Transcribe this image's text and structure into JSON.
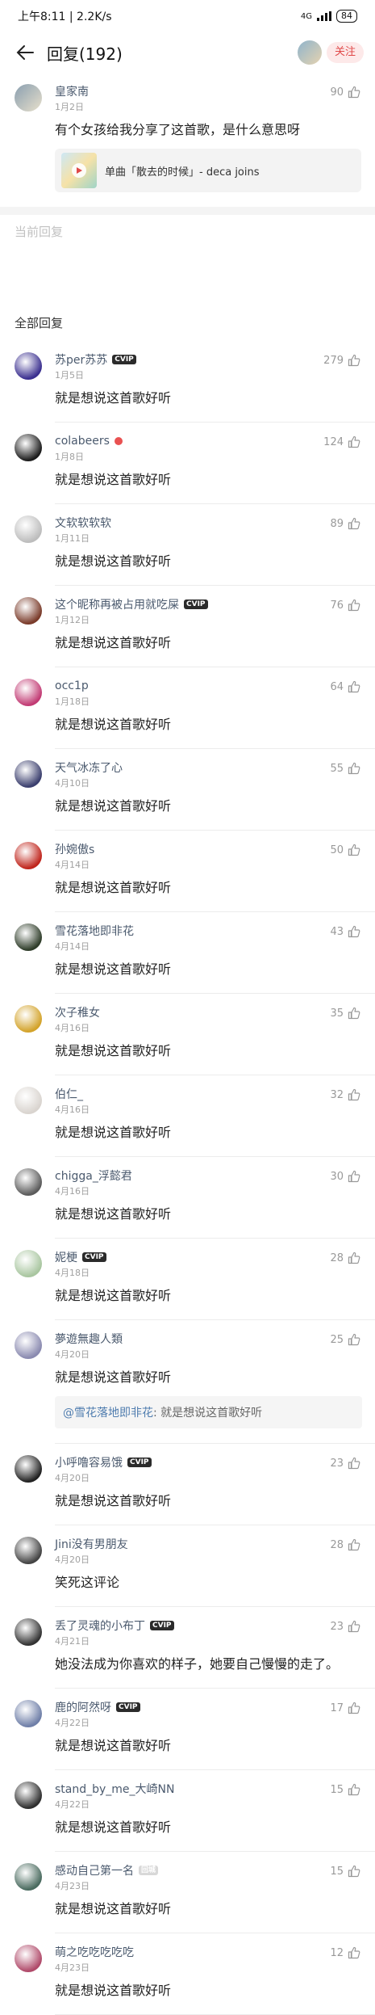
{
  "status": {
    "time_speed": "上午8:11 | 2.2K/s",
    "battery": "84",
    "net": "4G"
  },
  "header": {
    "title": "回复(192)",
    "follow_label": "关注"
  },
  "main_comment": {
    "user": "皇家南",
    "date": "1月2日",
    "likes": "90",
    "text": "有个女孩给我分享了这首歌，是什么意思呀",
    "music": "单曲「散去的时候」- deca joins"
  },
  "sections": {
    "current": "当前回复",
    "all": "全部回复"
  },
  "replies": [
    {
      "user": "苏per苏苏",
      "badge": "CVIP",
      "date": "1月5日",
      "likes": "279",
      "text": "就是想说这首歌好听",
      "color": "#3a2f8f"
    },
    {
      "user": "colabeers",
      "badge": "red",
      "date": "1月8日",
      "likes": "124",
      "text": "就是想说这首歌好听",
      "color": "#1c1c1c"
    },
    {
      "user": "文软软软软",
      "badge": "",
      "date": "1月11日",
      "likes": "89",
      "text": "就是想说这首歌好听",
      "color": "#bdbdbd"
    },
    {
      "user": "这个昵称再被占用就吃屎",
      "badge": "CVIP",
      "date": "1月12日",
      "likes": "76",
      "text": "就是想说这首歌好听",
      "color": "#7a3b2a"
    },
    {
      "user": "occ1p",
      "badge": "",
      "date": "1月18日",
      "likes": "64",
      "text": "就是想说这首歌好听",
      "color": "#c23b74"
    },
    {
      "user": "天气冰冻了心",
      "badge": "",
      "date": "4月10日",
      "likes": "55",
      "text": "就是想说这首歌好听",
      "color": "#3b3f6e"
    },
    {
      "user": "孙婉傲s",
      "badge": "",
      "date": "4月14日",
      "likes": "50",
      "text": "就是想说这首歌好听",
      "color": "#c0251c"
    },
    {
      "user": "雪花落地即非花",
      "badge": "",
      "date": "4月14日",
      "likes": "43",
      "text": "就是想说这首歌好听",
      "color": "#2f3d2a"
    },
    {
      "user": "次子稚女",
      "badge": "",
      "date": "4月16日",
      "likes": "35",
      "text": "就是想说这首歌好听",
      "color": "#d3a32a"
    },
    {
      "user": "伯仁_",
      "badge": "",
      "date": "4月16日",
      "likes": "32",
      "text": "就是想说这首歌好听",
      "color": "#d9d4cf"
    },
    {
      "user": "chigga_浮懿君",
      "badge": "",
      "date": "4月16日",
      "likes": "30",
      "text": "就是想说这首歌好听",
      "color": "#5b5b5b"
    },
    {
      "user": "妮梗",
      "badge": "CVIP",
      "date": "4月18日",
      "likes": "28",
      "text": "就是想说这首歌好听",
      "color": "#a9c6a0"
    },
    {
      "user": "夢遊無趣人類",
      "badge": "",
      "date": "4月20日",
      "likes": "25",
      "text": "就是想说这首歌好听",
      "color": "#8a8ab0",
      "quote_user": "@雪花落地即非花",
      "quote_text": ": 就是想说这首歌好听"
    },
    {
      "user": "小呼噜容易饿",
      "badge": "CVIP",
      "date": "4月20日",
      "likes": "23",
      "text": "就是想说这首歌好听",
      "color": "#222222"
    },
    {
      "user": "Jini没有男朋友",
      "badge": "",
      "date": "4月20日",
      "likes": "28",
      "text": "笑死这评论",
      "color": "#444444"
    },
    {
      "user": "丢了灵魂的小布丁",
      "badge": "CVIP",
      "date": "4月21日",
      "likes": "23",
      "text": "她没法成为你喜欢的样子，她要自己慢慢的走了。",
      "color": "#333333"
    },
    {
      "user": "鹿的阿然呀",
      "badge": "CVIP",
      "date": "4月22日",
      "likes": "17",
      "text": "就是想说这首歌好听",
      "color": "#6f7fa8"
    },
    {
      "user": "stand_by_me_大崎NN",
      "badge": "",
      "date": "4月22日",
      "likes": "15",
      "text": "就是想说这首歌好听",
      "color": "#2e2e2e"
    },
    {
      "user": "感动自己第一名",
      "badge": "gray",
      "date": "4月23日",
      "likes": "15",
      "text": "就是想说这首歌好听",
      "color": "#4a6b5f"
    },
    {
      "user": "萌之吃吃吃吃吃",
      "badge": "",
      "date": "4月23日",
      "likes": "12",
      "text": "就是想说这首歌好听",
      "color": "#b04a6a"
    }
  ],
  "badges": {
    "cvip": "CVIP",
    "gray": "回城"
  },
  "colors": {
    "accent": "#e04848",
    "name": "#4b5a6e",
    "quote_at": "#507daf"
  }
}
